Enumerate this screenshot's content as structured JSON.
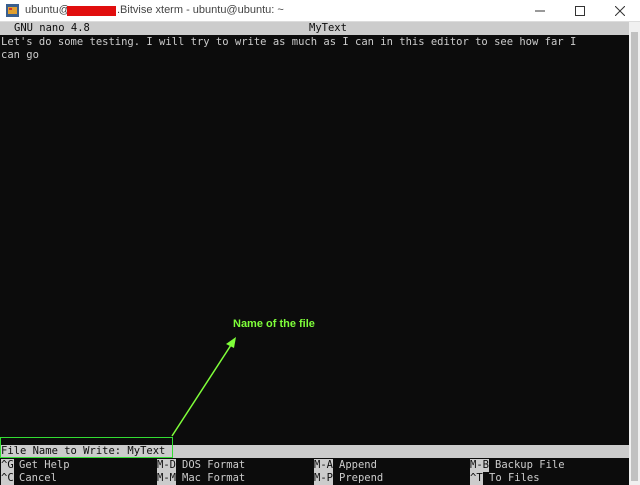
{
  "window": {
    "title_user": "ubuntu@",
    "title_rest": ".Bitvise xterm - ubuntu@ubuntu: ~",
    "minimize_icon": "minimize-icon",
    "maximize_icon": "maximize-icon",
    "close_icon": "close-icon"
  },
  "nano": {
    "version": "GNU nano 4.8",
    "filename": "MyText",
    "lines": [
      "Let's do some testing. I will try to write as much as I can in this editor to see how far I",
      "can go"
    ],
    "prompt": "File Name to Write: MyText",
    "shortcuts_row1": [
      {
        "key": "^G",
        "label": "Get Help"
      },
      {
        "key": "M-D",
        "label": "DOS Format"
      },
      {
        "key": "M-A",
        "label": "Append"
      },
      {
        "key": "M-B",
        "label": "Backup File"
      }
    ],
    "shortcuts_row2": [
      {
        "key": "^C",
        "label": "Cancel"
      },
      {
        "key": "M-M",
        "label": "Mac Format"
      },
      {
        "key": "M-P",
        "label": "Prepend"
      },
      {
        "key": "^T",
        "label": "To Files"
      }
    ]
  },
  "annotation": {
    "label": "Name of the file",
    "color": "#7fff3a"
  }
}
